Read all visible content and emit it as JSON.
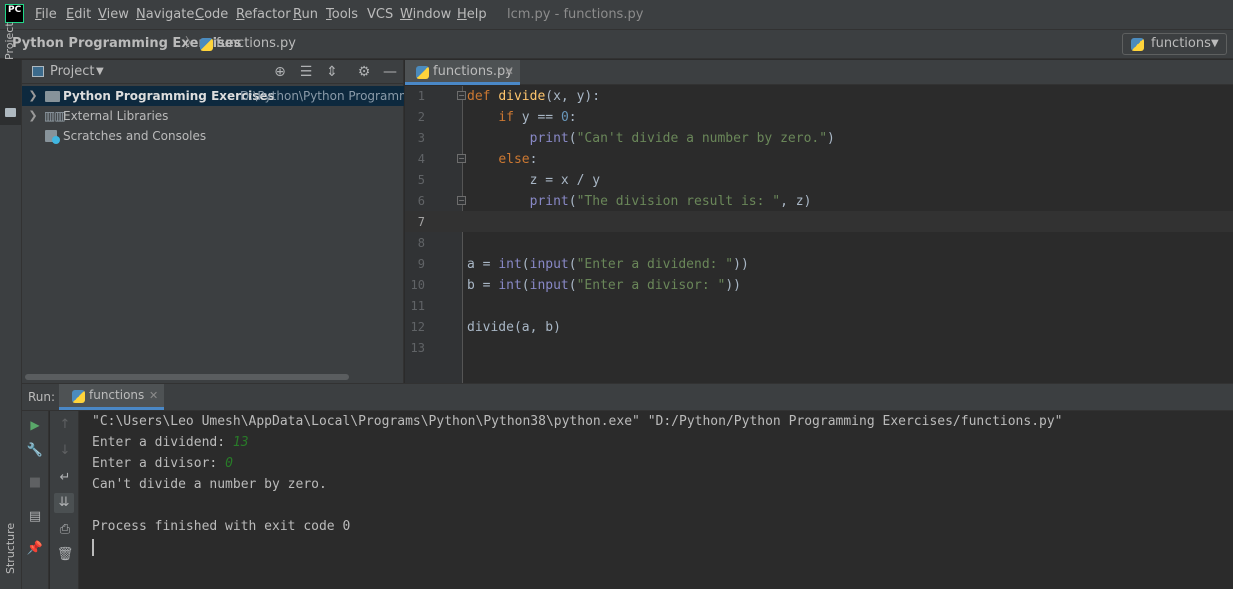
{
  "menubar": {
    "logo": "PC",
    "items": [
      {
        "mnemonic": "F",
        "rest": "ile"
      },
      {
        "mnemonic": "E",
        "rest": "dit"
      },
      {
        "mnemonic": "V",
        "rest": "iew"
      },
      {
        "mnemonic": "N",
        "rest": "avigate"
      },
      {
        "mnemonic": "C",
        "rest": "ode"
      },
      {
        "mnemonic": "R",
        "rest": "efactor"
      },
      {
        "mnemonic": "R",
        "rest": "un"
      },
      {
        "mnemonic": "T",
        "rest": "ools"
      },
      {
        "mnemonic": "",
        "rest": "VCS"
      },
      {
        "mnemonic": "W",
        "rest": "indow"
      },
      {
        "mnemonic": "H",
        "rest": "elp"
      }
    ],
    "window_title": "lcm.py - functions.py"
  },
  "navbar": {
    "project": "Python Programming Exercises",
    "separator": "〉",
    "file": "functions.py",
    "run_config": "functions"
  },
  "left_strip": {
    "project_tab": "Project",
    "structure_tab": "Structure"
  },
  "project_panel": {
    "title": "Project",
    "tree": {
      "project_name": "Python Programming Exercises",
      "project_path": "D:\\Python\\Python Programming Exercises",
      "external_libraries": "External Libraries",
      "scratches": "Scratches and Consoles"
    }
  },
  "editor": {
    "tab_label": "functions.py",
    "line_numbers": [
      "1",
      "2",
      "3",
      "4",
      "5",
      "6",
      "7",
      "8",
      "9",
      "10",
      "11",
      "12",
      "13"
    ],
    "code": {
      "l1_def": "def",
      "l1_name": "divide",
      "l1_params": "(x, y):",
      "l2_if": "if",
      "l2_expr": " y == ",
      "l2_num": "0",
      "l2_colon": ":",
      "l3_print": "print",
      "l3_open": "(",
      "l3_str": "\"Can't divide a number by zero.\"",
      "l3_close": ")",
      "l4_else": "else",
      "l4_colon": ":",
      "l5": "z = x / y",
      "l6_print": "print",
      "l6_open": "(",
      "l6_str": "\"The division result is: \"",
      "l6_rest": ", z)",
      "l9_a": "a = ",
      "l9_int": "int",
      "l9_open": "(",
      "l9_input": "input",
      "l9_open2": "(",
      "l9_str": "\"Enter a dividend: \"",
      "l9_close": "))",
      "l10_b": "b = ",
      "l10_int": "int",
      "l10_open": "(",
      "l10_input": "input",
      "l10_open2": "(",
      "l10_str": "\"Enter a divisor: \"",
      "l10_close": "))",
      "l12": "divide(a, b)"
    }
  },
  "run_panel": {
    "title": "Run:",
    "tab_label": "functions",
    "console": {
      "command": "\"C:\\Users\\Leo Umesh\\AppData\\Local\\Programs\\Python\\Python38\\python.exe\" \"D:/Python/Python Programming Exercises/functions.py\"",
      "prompt_dividend": "Enter a dividend: ",
      "input_dividend": "13",
      "prompt_divisor": "Enter a divisor: ",
      "input_divisor": "0",
      "message": "Can't divide a number by zero.",
      "exit": "Process finished with exit code 0"
    }
  },
  "colors": {
    "keyword": "#cc7832",
    "function": "#ffc66d",
    "string": "#6a8759",
    "number": "#6897bb",
    "builtin": "#8888c6",
    "user_input": "#287b28"
  }
}
